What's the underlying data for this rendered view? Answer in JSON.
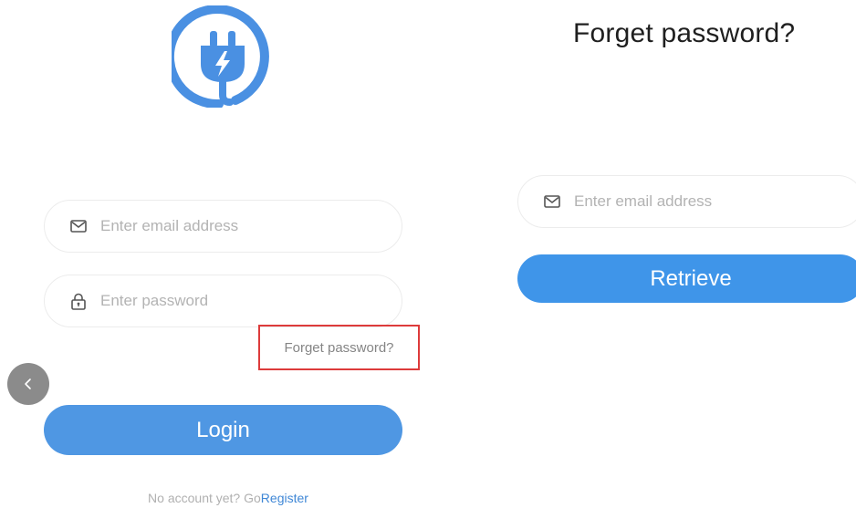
{
  "login": {
    "email_placeholder": "Enter email address",
    "password_placeholder": "Enter password",
    "forget_link": "Forget password?",
    "login_button": "Login",
    "no_account_text": "No account yet? Go",
    "register_link": "Register"
  },
  "retrieve": {
    "title": "Forget password?",
    "email_placeholder": "Enter email address",
    "retrieve_button": "Retrieve"
  },
  "icons": {
    "logo": "plug-lightning-logo",
    "email": "mail-icon",
    "password": "lock-icon",
    "back": "chevron-left-icon"
  },
  "colors": {
    "brand_blue": "#4a90e2",
    "button_blue": "#4f97e3",
    "highlight_red": "#dd3b3b"
  }
}
